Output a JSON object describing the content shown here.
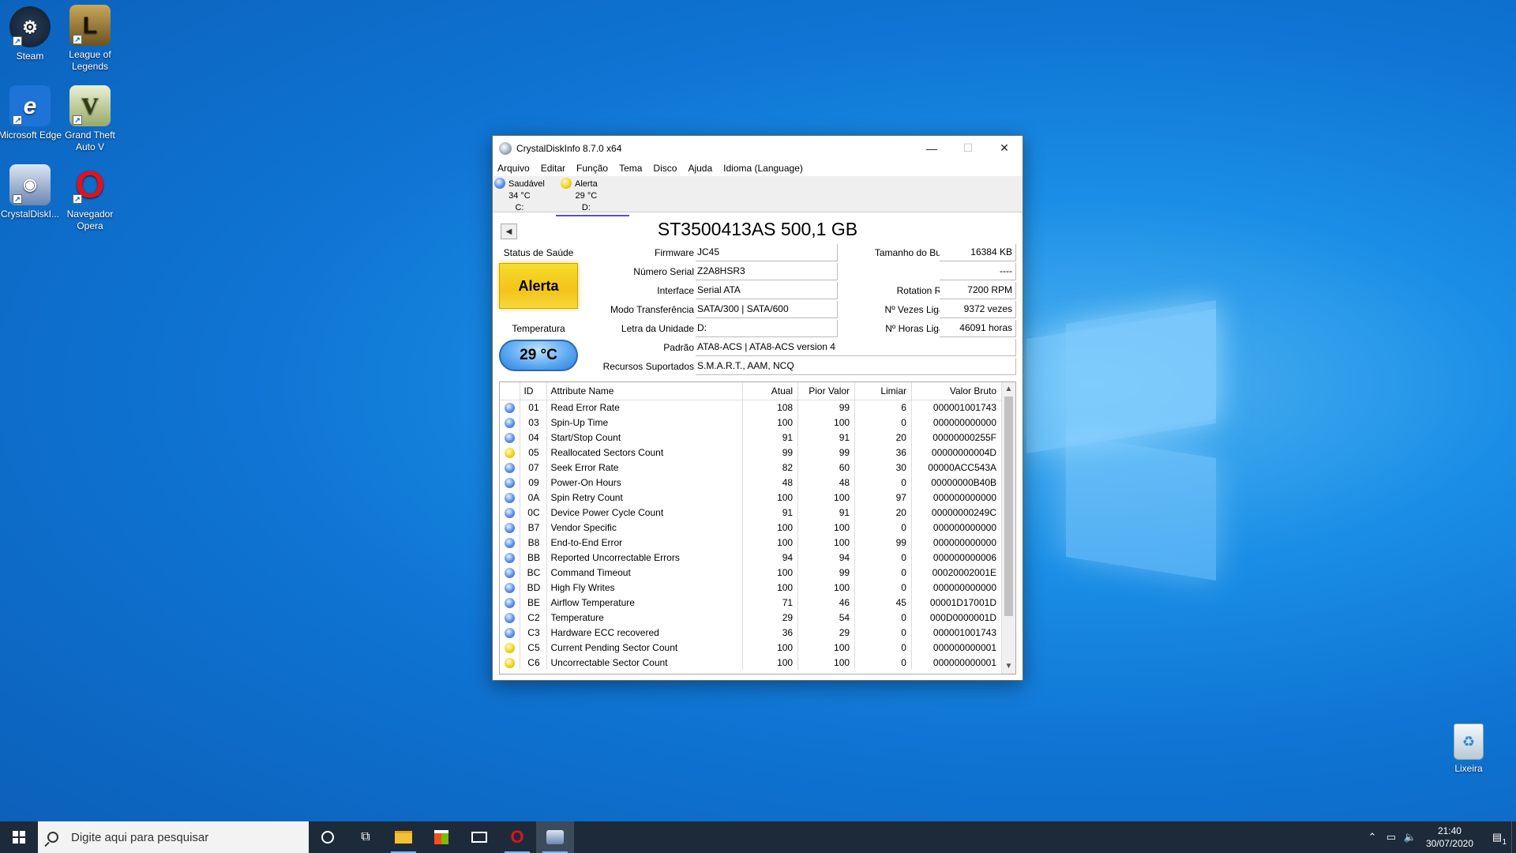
{
  "desktop": {
    "icons": [
      {
        "label": "Steam"
      },
      {
        "label": "League of Legends"
      },
      {
        "label": "Microsoft Edge"
      },
      {
        "label": "Grand Theft Auto V"
      },
      {
        "label": "CrystalDiskI..."
      },
      {
        "label": "Navegador Opera"
      }
    ],
    "recycle_bin": "Lixeira"
  },
  "window": {
    "title": "CrystalDiskInfo 8.7.0 x64",
    "menu": [
      "Arquivo",
      "Editar",
      "Função",
      "Tema",
      "Disco",
      "Ajuda",
      "Idioma (Language)"
    ],
    "drives": [
      {
        "status": "Saudável",
        "temp": "34 °C",
        "letter": "C:",
        "color": "#4a90e2"
      },
      {
        "status": "Alerta",
        "temp": "29 °C",
        "letter": "D:",
        "color": "#f2d21c"
      }
    ],
    "model": "ST3500413AS 500,1 GB",
    "health_label": "Status de Saúde",
    "health_value": "Alerta",
    "temp_label": "Temperatura",
    "temp_value": "29 °C",
    "info": {
      "firmware_label": "Firmware",
      "firmware": "JC45",
      "serial_label": "Número Serial",
      "serial": "Z2A8HSR3",
      "interface_label": "Interface",
      "interface": "Serial ATA",
      "transfer_label": "Modo Transferência",
      "transfer": "SATA/300 | SATA/600",
      "drive_letter_label": "Letra da Unidade",
      "drive_letter": "D:",
      "standard_label": "Padrão",
      "standard": "ATA8-ACS | ATA8-ACS version 4",
      "features_label": "Recursos Suportados",
      "features": "S.M.A.R.T., AAM, NCQ",
      "buffer_label": "Tamanho do Buffer",
      "buffer": "16384 KB",
      "blank_label": "----",
      "blank": "----",
      "rotation_label": "Rotation Rate",
      "rotation": "7200 RPM",
      "power_count_label": "Nº Vezes Ligado",
      "power_count": "9372 vezes",
      "power_hours_label": "Nº Horas Ligado",
      "power_hours": "46091 horas"
    },
    "smart_headers": [
      "ID",
      "Attribute Name",
      "Atual",
      "Pior Valor",
      "Limiar",
      "Valor Bruto"
    ],
    "smart_rows": [
      {
        "s": "good",
        "id": "01",
        "name": "Read Error Rate",
        "cur": "108",
        "worst": "99",
        "thr": "6",
        "raw": "000001001743"
      },
      {
        "s": "good",
        "id": "03",
        "name": "Spin-Up Time",
        "cur": "100",
        "worst": "100",
        "thr": "0",
        "raw": "000000000000"
      },
      {
        "s": "good",
        "id": "04",
        "name": "Start/Stop Count",
        "cur": "91",
        "worst": "91",
        "thr": "20",
        "raw": "00000000255F"
      },
      {
        "s": "warn",
        "id": "05",
        "name": "Reallocated Sectors Count",
        "cur": "99",
        "worst": "99",
        "thr": "36",
        "raw": "00000000004D"
      },
      {
        "s": "good",
        "id": "07",
        "name": "Seek Error Rate",
        "cur": "82",
        "worst": "60",
        "thr": "30",
        "raw": "00000ACC543A"
      },
      {
        "s": "good",
        "id": "09",
        "name": "Power-On Hours",
        "cur": "48",
        "worst": "48",
        "thr": "0",
        "raw": "00000000B40B"
      },
      {
        "s": "good",
        "id": "0A",
        "name": "Spin Retry Count",
        "cur": "100",
        "worst": "100",
        "thr": "97",
        "raw": "000000000000"
      },
      {
        "s": "good",
        "id": "0C",
        "name": "Device Power Cycle Count",
        "cur": "91",
        "worst": "91",
        "thr": "20",
        "raw": "00000000249C"
      },
      {
        "s": "good",
        "id": "B7",
        "name": "Vendor Specific",
        "cur": "100",
        "worst": "100",
        "thr": "0",
        "raw": "000000000000"
      },
      {
        "s": "good",
        "id": "B8",
        "name": "End-to-End Error",
        "cur": "100",
        "worst": "100",
        "thr": "99",
        "raw": "000000000000"
      },
      {
        "s": "good",
        "id": "BB",
        "name": "Reported Uncorrectable Errors",
        "cur": "94",
        "worst": "94",
        "thr": "0",
        "raw": "000000000006"
      },
      {
        "s": "good",
        "id": "BC",
        "name": "Command Timeout",
        "cur": "100",
        "worst": "99",
        "thr": "0",
        "raw": "00020002001E"
      },
      {
        "s": "good",
        "id": "BD",
        "name": "High Fly Writes",
        "cur": "100",
        "worst": "100",
        "thr": "0",
        "raw": "000000000000"
      },
      {
        "s": "good",
        "id": "BE",
        "name": "Airflow Temperature",
        "cur": "71",
        "worst": "46",
        "thr": "45",
        "raw": "00001D17001D"
      },
      {
        "s": "good",
        "id": "C2",
        "name": "Temperature",
        "cur": "29",
        "worst": "54",
        "thr": "0",
        "raw": "000D0000001D"
      },
      {
        "s": "good",
        "id": "C3",
        "name": "Hardware ECC recovered",
        "cur": "36",
        "worst": "29",
        "thr": "0",
        "raw": "000001001743"
      },
      {
        "s": "warn",
        "id": "C5",
        "name": "Current Pending Sector Count",
        "cur": "100",
        "worst": "100",
        "thr": "0",
        "raw": "000000000001"
      },
      {
        "s": "warn",
        "id": "C6",
        "name": "Uncorrectable Sector Count",
        "cur": "100",
        "worst": "100",
        "thr": "0",
        "raw": "000000000001"
      }
    ]
  },
  "taskbar": {
    "search_placeholder": "Digite aqui para pesquisar",
    "time": "21:40",
    "date": "30/07/2020",
    "notification_count": "1"
  }
}
